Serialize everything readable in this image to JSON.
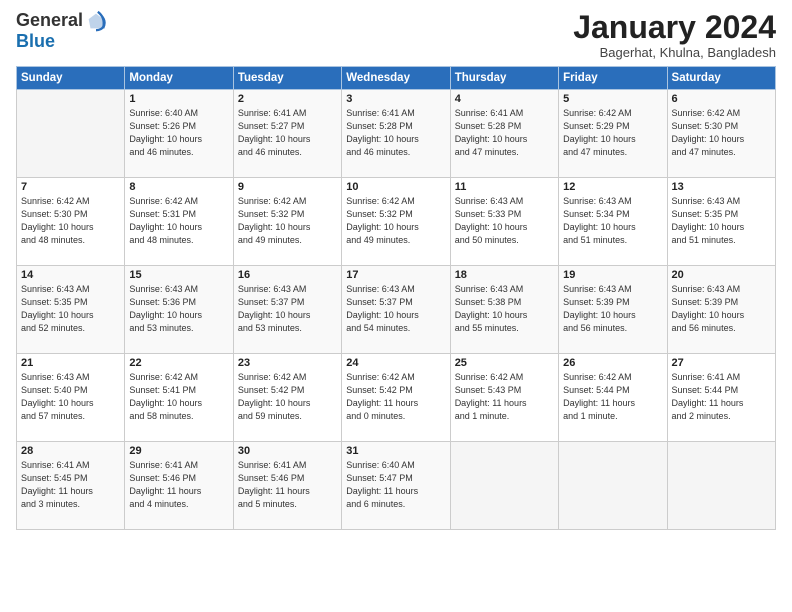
{
  "header": {
    "logo_general": "General",
    "logo_blue": "Blue",
    "month_title": "January 2024",
    "location": "Bagerhat, Khulna, Bangladesh"
  },
  "days_of_week": [
    "Sunday",
    "Monday",
    "Tuesday",
    "Wednesday",
    "Thursday",
    "Friday",
    "Saturday"
  ],
  "weeks": [
    [
      {
        "day": "",
        "info": ""
      },
      {
        "day": "1",
        "info": "Sunrise: 6:40 AM\nSunset: 5:26 PM\nDaylight: 10 hours\nand 46 minutes."
      },
      {
        "day": "2",
        "info": "Sunrise: 6:41 AM\nSunset: 5:27 PM\nDaylight: 10 hours\nand 46 minutes."
      },
      {
        "day": "3",
        "info": "Sunrise: 6:41 AM\nSunset: 5:28 PM\nDaylight: 10 hours\nand 46 minutes."
      },
      {
        "day": "4",
        "info": "Sunrise: 6:41 AM\nSunset: 5:28 PM\nDaylight: 10 hours\nand 47 minutes."
      },
      {
        "day": "5",
        "info": "Sunrise: 6:42 AM\nSunset: 5:29 PM\nDaylight: 10 hours\nand 47 minutes."
      },
      {
        "day": "6",
        "info": "Sunrise: 6:42 AM\nSunset: 5:30 PM\nDaylight: 10 hours\nand 47 minutes."
      }
    ],
    [
      {
        "day": "7",
        "info": "Sunrise: 6:42 AM\nSunset: 5:30 PM\nDaylight: 10 hours\nand 48 minutes."
      },
      {
        "day": "8",
        "info": "Sunrise: 6:42 AM\nSunset: 5:31 PM\nDaylight: 10 hours\nand 48 minutes."
      },
      {
        "day": "9",
        "info": "Sunrise: 6:42 AM\nSunset: 5:32 PM\nDaylight: 10 hours\nand 49 minutes."
      },
      {
        "day": "10",
        "info": "Sunrise: 6:42 AM\nSunset: 5:32 PM\nDaylight: 10 hours\nand 49 minutes."
      },
      {
        "day": "11",
        "info": "Sunrise: 6:43 AM\nSunset: 5:33 PM\nDaylight: 10 hours\nand 50 minutes."
      },
      {
        "day": "12",
        "info": "Sunrise: 6:43 AM\nSunset: 5:34 PM\nDaylight: 10 hours\nand 51 minutes."
      },
      {
        "day": "13",
        "info": "Sunrise: 6:43 AM\nSunset: 5:35 PM\nDaylight: 10 hours\nand 51 minutes."
      }
    ],
    [
      {
        "day": "14",
        "info": "Sunrise: 6:43 AM\nSunset: 5:35 PM\nDaylight: 10 hours\nand 52 minutes."
      },
      {
        "day": "15",
        "info": "Sunrise: 6:43 AM\nSunset: 5:36 PM\nDaylight: 10 hours\nand 53 minutes."
      },
      {
        "day": "16",
        "info": "Sunrise: 6:43 AM\nSunset: 5:37 PM\nDaylight: 10 hours\nand 53 minutes."
      },
      {
        "day": "17",
        "info": "Sunrise: 6:43 AM\nSunset: 5:37 PM\nDaylight: 10 hours\nand 54 minutes."
      },
      {
        "day": "18",
        "info": "Sunrise: 6:43 AM\nSunset: 5:38 PM\nDaylight: 10 hours\nand 55 minutes."
      },
      {
        "day": "19",
        "info": "Sunrise: 6:43 AM\nSunset: 5:39 PM\nDaylight: 10 hours\nand 56 minutes."
      },
      {
        "day": "20",
        "info": "Sunrise: 6:43 AM\nSunset: 5:39 PM\nDaylight: 10 hours\nand 56 minutes."
      }
    ],
    [
      {
        "day": "21",
        "info": "Sunrise: 6:43 AM\nSunset: 5:40 PM\nDaylight: 10 hours\nand 57 minutes."
      },
      {
        "day": "22",
        "info": "Sunrise: 6:42 AM\nSunset: 5:41 PM\nDaylight: 10 hours\nand 58 minutes."
      },
      {
        "day": "23",
        "info": "Sunrise: 6:42 AM\nSunset: 5:42 PM\nDaylight: 10 hours\nand 59 minutes."
      },
      {
        "day": "24",
        "info": "Sunrise: 6:42 AM\nSunset: 5:42 PM\nDaylight: 11 hours\nand 0 minutes."
      },
      {
        "day": "25",
        "info": "Sunrise: 6:42 AM\nSunset: 5:43 PM\nDaylight: 11 hours\nand 1 minute."
      },
      {
        "day": "26",
        "info": "Sunrise: 6:42 AM\nSunset: 5:44 PM\nDaylight: 11 hours\nand 1 minute."
      },
      {
        "day": "27",
        "info": "Sunrise: 6:41 AM\nSunset: 5:44 PM\nDaylight: 11 hours\nand 2 minutes."
      }
    ],
    [
      {
        "day": "28",
        "info": "Sunrise: 6:41 AM\nSunset: 5:45 PM\nDaylight: 11 hours\nand 3 minutes."
      },
      {
        "day": "29",
        "info": "Sunrise: 6:41 AM\nSunset: 5:46 PM\nDaylight: 11 hours\nand 4 minutes."
      },
      {
        "day": "30",
        "info": "Sunrise: 6:41 AM\nSunset: 5:46 PM\nDaylight: 11 hours\nand 5 minutes."
      },
      {
        "day": "31",
        "info": "Sunrise: 6:40 AM\nSunset: 5:47 PM\nDaylight: 11 hours\nand 6 minutes."
      },
      {
        "day": "",
        "info": ""
      },
      {
        "day": "",
        "info": ""
      },
      {
        "day": "",
        "info": ""
      }
    ]
  ]
}
